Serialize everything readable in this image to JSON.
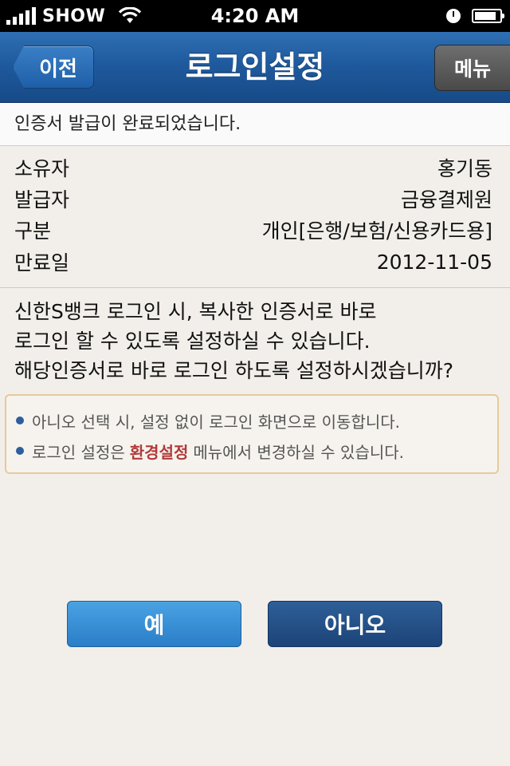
{
  "status_bar": {
    "carrier": "SHOW",
    "time": "4:20 AM",
    "icons": [
      "signal-icon",
      "wifi-icon",
      "clock-icon",
      "battery-icon"
    ]
  },
  "nav": {
    "back_label": "이전",
    "title": "로그인설정",
    "menu_label": "메뉴"
  },
  "notice": "인증서 발급이 완료되었습니다.",
  "info": {
    "rows": [
      {
        "label": "소유자",
        "value": "홍기동"
      },
      {
        "label": "발급자",
        "value": "금융결제원"
      },
      {
        "label": "구분",
        "value": "개인[은행/보험/신용카드용]"
      },
      {
        "label": "만료일",
        "value": "2012-11-05"
      }
    ]
  },
  "question": {
    "lines": [
      "신한S뱅크 로그인 시, 복사한 인증서로 바로",
      "로그인 할 수 있도록 설정하실 수 있습니다.",
      "해당인증서로 바로 로그인 하도록 설정하시겠습니까?"
    ]
  },
  "notes": {
    "note1": "아니오 선택 시, 설정 없이 로그인 화면으로 이동합니다.",
    "note2_before": "로그인 설정은",
    "note2_highlight": "환경설정",
    "note2_after": "메뉴에서 변경하실 수 있습니다.",
    "highlight_color": "#b23a3a"
  },
  "buttons": {
    "yes_label": "예",
    "no_label": "아니오"
  },
  "colors": {
    "nav_blue": "#1f5a9e",
    "background": "#f2efea"
  }
}
